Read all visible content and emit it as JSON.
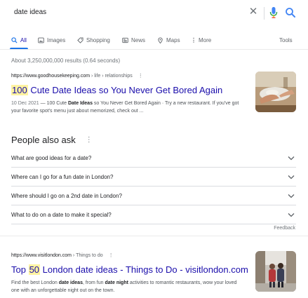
{
  "search": {
    "query": "date ideas"
  },
  "tabs": [
    {
      "label": "All",
      "active": true
    },
    {
      "label": "Images"
    },
    {
      "label": "Shopping"
    },
    {
      "label": "News"
    },
    {
      "label": "Maps"
    },
    {
      "label": "More"
    }
  ],
  "tools_label": "Tools",
  "results_stats": "About 3,250,000,000 results (0.64 seconds)",
  "results": [
    {
      "cite_domain": "https://www.goodhousekeeping.com",
      "cite_path": " › life › relationships",
      "title_highlight": "100",
      "title_rest": " Cute Date Ideas so You Never Get Bored Again",
      "snippet_date": "10 Dec 2021",
      "snippet_pre": " — 100 Cute ",
      "snippet_bold": "Date Ideas",
      "snippet_post": " so You Never Get Bored Again · Try a new restaurant. If you've got your favorite spot's menu just about memorized, check out ..."
    },
    {
      "cite_domain": "https://www.visitlondon.com",
      "cite_path": " › Things to do",
      "title_pre": "Top ",
      "title_highlight": "50",
      "title_rest": " London date ideas - Things to Do - visitlondon.com",
      "snippet_1": "Find the best London ",
      "snippet_bold_1": "date ideas",
      "snippet_2": ", from fun ",
      "snippet_bold_2": "date night",
      "snippet_3": " activities to romantic restaurants, wow your loved one with an unforgettable night out on the town."
    }
  ],
  "people_also_ask": {
    "title": "People also ask",
    "questions": [
      "What are good ideas for a date?",
      "Where can I go for a fun date in London?",
      "Where should I go on a 2nd date in London?",
      "What to do on a date to make it special?"
    ]
  },
  "feedback_label": "Feedback",
  "colors": {
    "link": "#1a0dab",
    "accent": "#1a73e8",
    "highlight": "#fef3a1"
  }
}
